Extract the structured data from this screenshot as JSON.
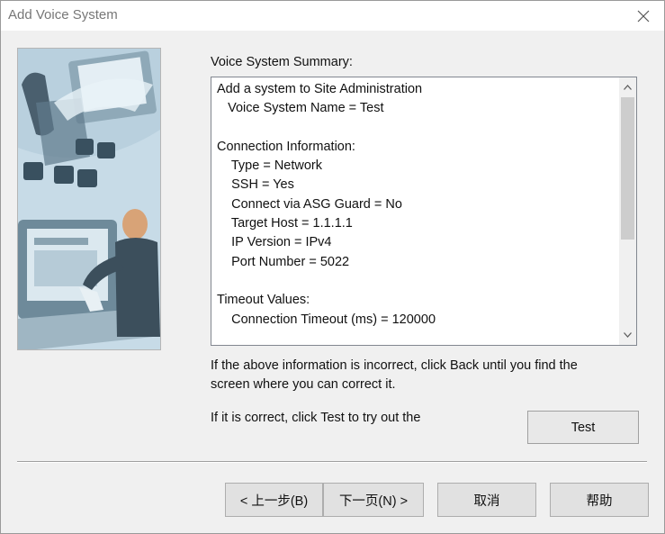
{
  "window": {
    "title": "Add Voice System"
  },
  "summary": {
    "label": "Voice System Summary:",
    "text": "Add a system to Site Administration\n   Voice System Name = Test\n\nConnection Information:\n    Type = Network\n    SSH = Yes\n    Connect via ASG Guard = No\n    Target Host = 1.1.1.1\n    IP Version = IPv4\n    Port Number = 5022\n\nTimeout Values:\n    Connection Timeout (ms) = 120000"
  },
  "instructions": {
    "incorrect": "If the above information is incorrect, click Back until you find the",
    "incorrect2": "screen where you can correct it.",
    "correct": "If it is correct, click Test to try out the"
  },
  "buttons": {
    "test": "Test",
    "back": "< 上一步(B)",
    "next": "下一页(N) >",
    "cancel": "取消",
    "help": "帮助"
  },
  "icons": {
    "close": "close-icon",
    "up": "scroll-up-arrow-icon",
    "down": "scroll-down-arrow-icon",
    "illustration": "wizard-illustration"
  }
}
